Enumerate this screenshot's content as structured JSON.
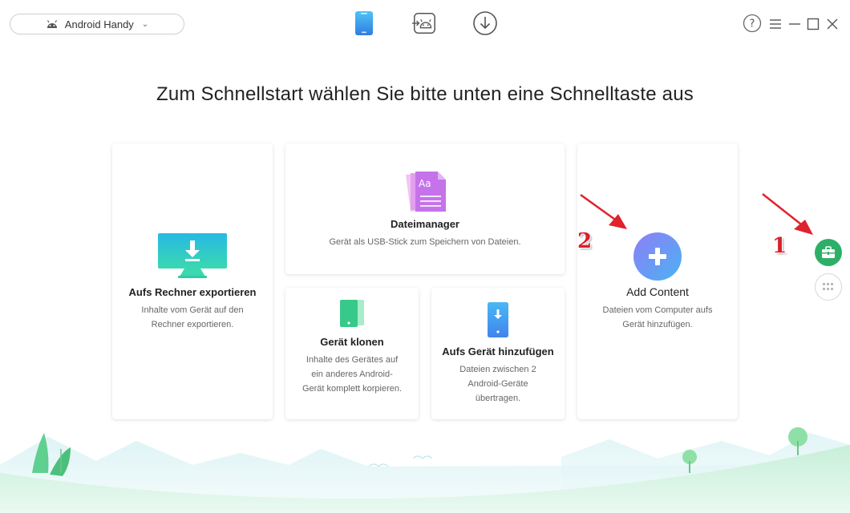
{
  "header": {
    "device_label": "Android Handy",
    "nav": [
      "phone-manager",
      "android-mover",
      "downloader"
    ]
  },
  "main": {
    "title": "Zum Schnellstart wählen Sie bitte unten eine Schnelltaste aus"
  },
  "cards": {
    "export": {
      "title": "Aufs Rechner exportieren",
      "desc": "Inhalte vom Gerät auf den Rechner exportieren."
    },
    "filemanager": {
      "title": "Dateimanager",
      "desc": "Gerät als USB-Stick zum Speichern von Dateien."
    },
    "clone": {
      "title": "Gerät klonen",
      "desc": "Inhalte des Gerätes auf ein anderes Android-Gerät komplett korpieren."
    },
    "add_to_device": {
      "title": "Aufs Gerät hinzufügen",
      "desc": "Dateien zwischen 2 Android-Geräte übertragen."
    },
    "add_content": {
      "title": "Add Content",
      "desc": "Dateien vom Computer aufs Gerät hinzufügen."
    }
  },
  "annotations": {
    "one": "1",
    "two": "2"
  },
  "colors": {
    "accent": "#4a8ff0",
    "green": "#2fb36b",
    "arrow": "#e0222c"
  }
}
